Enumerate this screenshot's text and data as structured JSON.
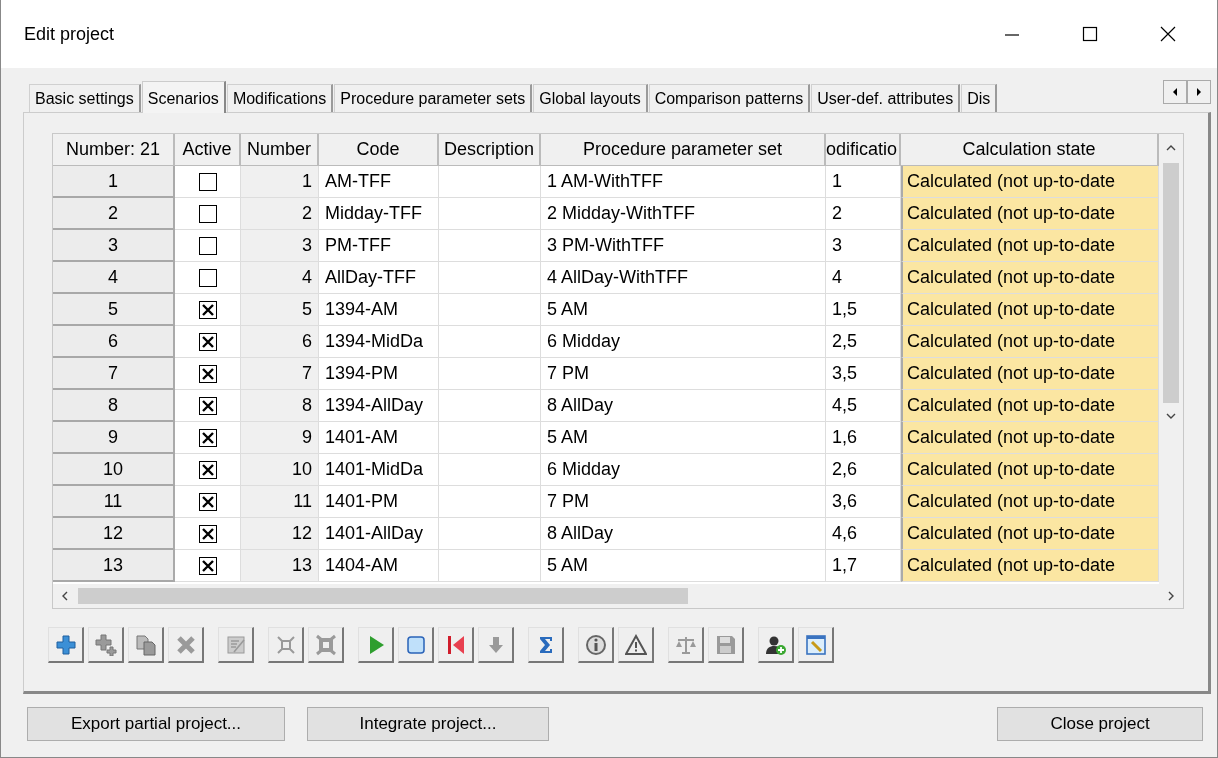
{
  "window": {
    "title": "Edit project"
  },
  "tabs": [
    {
      "label": "Basic settings",
      "selected": false
    },
    {
      "label": "Scenarios",
      "selected": true
    },
    {
      "label": "Modifications",
      "selected": false
    },
    {
      "label": "Procedure parameter sets",
      "selected": false
    },
    {
      "label": "Global layouts",
      "selected": false
    },
    {
      "label": "Comparison patterns",
      "selected": false
    },
    {
      "label": "User-def. attributes",
      "selected": false
    },
    {
      "label": "Dis",
      "selected": false
    }
  ],
  "table": {
    "corner": "Number: 21",
    "columns": [
      "Active",
      "Number",
      "Code",
      "Description",
      "Procedure parameter set",
      "odificatio",
      "Calculation state"
    ],
    "rows": [
      {
        "row_header": "1",
        "active": false,
        "number": "1",
        "code": "AM-TFF",
        "parameter_set": "1 AM-WithTFF",
        "modification": "1",
        "state": "Calculated (not up-to-date"
      },
      {
        "row_header": "2",
        "active": false,
        "number": "2",
        "code": "Midday-TFF",
        "parameter_set": "2 Midday-WithTFF",
        "modification": "2",
        "state": "Calculated (not up-to-date"
      },
      {
        "row_header": "3",
        "active": false,
        "number": "3",
        "code": "PM-TFF",
        "parameter_set": "3 PM-WithTFF",
        "modification": "3",
        "state": "Calculated (not up-to-date"
      },
      {
        "row_header": "4",
        "active": false,
        "number": "4",
        "code": "AllDay-TFF",
        "parameter_set": "4 AllDay-WithTFF",
        "modification": "4",
        "state": "Calculated (not up-to-date"
      },
      {
        "row_header": "5",
        "active": true,
        "number": "5",
        "code": "1394-AM",
        "parameter_set": "5 AM",
        "modification": "1,5",
        "state": "Calculated (not up-to-date"
      },
      {
        "row_header": "6",
        "active": true,
        "number": "6",
        "code": "1394-MidDa",
        "parameter_set": "6 Midday",
        "modification": "2,5",
        "state": "Calculated (not up-to-date"
      },
      {
        "row_header": "7",
        "active": true,
        "number": "7",
        "code": "1394-PM",
        "parameter_set": "7 PM",
        "modification": "3,5",
        "state": "Calculated (not up-to-date"
      },
      {
        "row_header": "8",
        "active": true,
        "number": "8",
        "code": "1394-AllDay",
        "parameter_set": "8 AllDay",
        "modification": "4,5",
        "state": "Calculated (not up-to-date"
      },
      {
        "row_header": "9",
        "active": true,
        "number": "9",
        "code": "1401-AM",
        "parameter_set": "5 AM",
        "modification": "1,6",
        "state": "Calculated (not up-to-date"
      },
      {
        "row_header": "10",
        "active": true,
        "number": "10",
        "code": "1401-MidDa",
        "parameter_set": "6 Midday",
        "modification": "2,6",
        "state": "Calculated (not up-to-date"
      },
      {
        "row_header": "11",
        "active": true,
        "number": "11",
        "code": "1401-PM",
        "parameter_set": "7 PM",
        "modification": "3,6",
        "state": "Calculated (not up-to-date"
      },
      {
        "row_header": "12",
        "active": true,
        "number": "12",
        "code": "1401-AllDay",
        "parameter_set": "8 AllDay",
        "modification": "4,6",
        "state": "Calculated (not up-to-date"
      },
      {
        "row_header": "13",
        "active": true,
        "number": "13",
        "code": "1404-AM",
        "parameter_set": "5 AM",
        "modification": "1,7",
        "state": "Calculated (not up-to-date"
      }
    ]
  },
  "toolbar": [
    [
      {
        "kind": "add",
        "disabled": false
      },
      {
        "kind": "add-copy",
        "disabled": true
      },
      {
        "kind": "copy",
        "disabled": true
      },
      {
        "kind": "delete",
        "disabled": true
      }
    ],
    [
      {
        "kind": "edit",
        "disabled": true
      }
    ],
    [
      {
        "kind": "net",
        "disabled": true
      },
      {
        "kind": "net-filled",
        "disabled": true
      }
    ],
    [
      {
        "kind": "run",
        "disabled": false
      },
      {
        "kind": "stop",
        "disabled": false
      },
      {
        "kind": "reset",
        "disabled": false
      },
      {
        "kind": "down",
        "disabled": true
      }
    ],
    [
      {
        "kind": "sigma",
        "disabled": false
      }
    ],
    [
      {
        "kind": "info",
        "disabled": false
      },
      {
        "kind": "warning",
        "disabled": false
      }
    ],
    [
      {
        "kind": "scale",
        "disabled": true
      },
      {
        "kind": "save",
        "disabled": true
      }
    ],
    [
      {
        "kind": "user-add",
        "disabled": false
      },
      {
        "kind": "config",
        "disabled": false
      }
    ]
  ],
  "buttons": [
    "Export partial project...",
    "Integrate project...",
    "Close project"
  ]
}
